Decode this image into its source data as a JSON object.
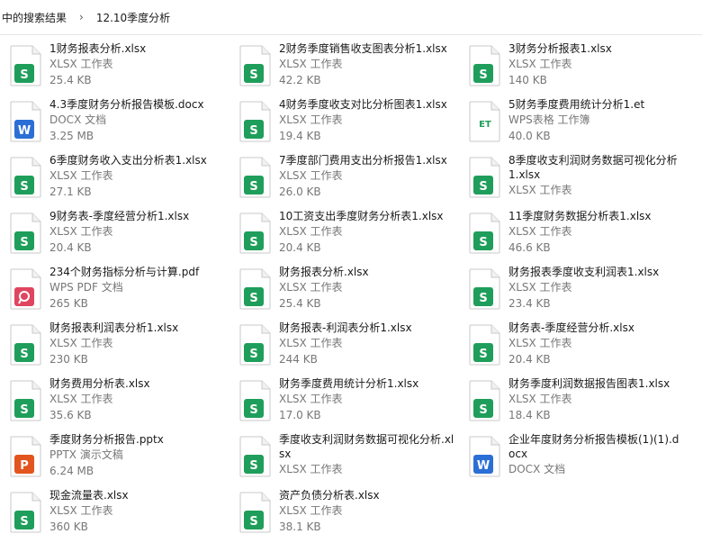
{
  "breadcrumb": [
    "中的搜索结果",
    "12.10季度分析"
  ],
  "colors": {
    "xlsx": "#1f9e5b",
    "docx": "#2b6fd6",
    "et": "#1f9e5b",
    "pdf": "#e0455f",
    "pptx": "#e2551f"
  },
  "files": [
    {
      "name": "1财务报表分析.xlsx",
      "type": "XLSX 工作表",
      "size": "25.4 KB",
      "icon": "xlsx-icon",
      "glyph": "S"
    },
    {
      "name": "2财务季度销售收支图表分析1.xlsx",
      "type": "XLSX 工作表",
      "size": "42.2 KB",
      "icon": "xlsx-icon",
      "glyph": "S"
    },
    {
      "name": "3财务分析报表1.xlsx",
      "type": "XLSX 工作表",
      "size": "140 KB",
      "icon": "xlsx-icon",
      "glyph": "S"
    },
    {
      "name": "4.3季度财务分析报告模板.docx",
      "type": "DOCX 文档",
      "size": "3.25 MB",
      "icon": "docx-icon",
      "glyph": "W"
    },
    {
      "name": "4财务季度收支对比分析图表1.xlsx",
      "type": "XLSX 工作表",
      "size": "19.4 KB",
      "icon": "xlsx-icon",
      "glyph": "S"
    },
    {
      "name": "5财务季度费用统计分析1.et",
      "type": "WPS表格 工作簿",
      "size": "40.0 KB",
      "icon": "et-icon",
      "glyph": "ET"
    },
    {
      "name": "6季度财务收入支出分析表1.xlsx",
      "type": "XLSX 工作表",
      "size": "27.1 KB",
      "icon": "xlsx-icon",
      "glyph": "S"
    },
    {
      "name": "7季度部门费用支出分析报告1.xlsx",
      "type": "XLSX 工作表",
      "size": "26.0 KB",
      "icon": "xlsx-icon",
      "glyph": "S"
    },
    {
      "name": "8季度收支利润财务数据可视化分析1.xlsx",
      "type": "XLSX 工作表",
      "size": "",
      "icon": "xlsx-icon",
      "glyph": "S"
    },
    {
      "name": "9财务表-季度经营分析1.xlsx",
      "type": "XLSX 工作表",
      "size": "20.4 KB",
      "icon": "xlsx-icon",
      "glyph": "S"
    },
    {
      "name": "10工资支出季度财务分析表1.xlsx",
      "type": "XLSX 工作表",
      "size": "20.4 KB",
      "icon": "xlsx-icon",
      "glyph": "S"
    },
    {
      "name": "11季度财务数据分析表1.xlsx",
      "type": "XLSX 工作表",
      "size": "46.6 KB",
      "icon": "xlsx-icon",
      "glyph": "S"
    },
    {
      "name": "234个财务指标分析与计算.pdf",
      "type": "WPS PDF 文档",
      "size": "265 KB",
      "icon": "pdf-icon",
      "glyph": "P"
    },
    {
      "name": "财务报表分析.xlsx",
      "type": "XLSX 工作表",
      "size": "25.4 KB",
      "icon": "xlsx-icon",
      "glyph": "S"
    },
    {
      "name": "财务报表季度收支利润表1.xlsx",
      "type": "XLSX 工作表",
      "size": "23.4 KB",
      "icon": "xlsx-icon",
      "glyph": "S"
    },
    {
      "name": "财务报表利润表分析1.xlsx",
      "type": "XLSX 工作表",
      "size": "230 KB",
      "icon": "xlsx-icon",
      "glyph": "S"
    },
    {
      "name": "财务报表-利润表分析1.xlsx",
      "type": "XLSX 工作表",
      "size": "244 KB",
      "icon": "xlsx-icon",
      "glyph": "S"
    },
    {
      "name": "财务表-季度经营分析.xlsx",
      "type": "XLSX 工作表",
      "size": "20.4 KB",
      "icon": "xlsx-icon",
      "glyph": "S"
    },
    {
      "name": "财务费用分析表.xlsx",
      "type": "XLSX 工作表",
      "size": "35.6 KB",
      "icon": "xlsx-icon",
      "glyph": "S"
    },
    {
      "name": "财务季度费用统计分析1.xlsx",
      "type": "XLSX 工作表",
      "size": "17.0 KB",
      "icon": "xlsx-icon",
      "glyph": "S"
    },
    {
      "name": "财务季度利润数据报告图表1.xlsx",
      "type": "XLSX 工作表",
      "size": "18.4 KB",
      "icon": "xlsx-icon",
      "glyph": "S"
    },
    {
      "name": "季度财务分析报告.pptx",
      "type": "PPTX 演示文稿",
      "size": "6.24 MB",
      "icon": "pptx-icon",
      "glyph": "P"
    },
    {
      "name": "季度收支利润财务数据可视化分析.xlsx",
      "type": "XLSX 工作表",
      "size": "",
      "icon": "xlsx-icon",
      "glyph": "S"
    },
    {
      "name": "企业年度财务分析报告模板(1)(1).docx",
      "type": "DOCX 文档",
      "size": "",
      "icon": "docx-icon",
      "glyph": "W"
    },
    {
      "name": "现金流量表.xlsx",
      "type": "XLSX 工作表",
      "size": "360 KB",
      "icon": "xlsx-icon",
      "glyph": "S"
    },
    {
      "name": "资产负债分析表.xlsx",
      "type": "XLSX 工作表",
      "size": "38.1 KB",
      "icon": "xlsx-icon",
      "glyph": "S"
    }
  ]
}
